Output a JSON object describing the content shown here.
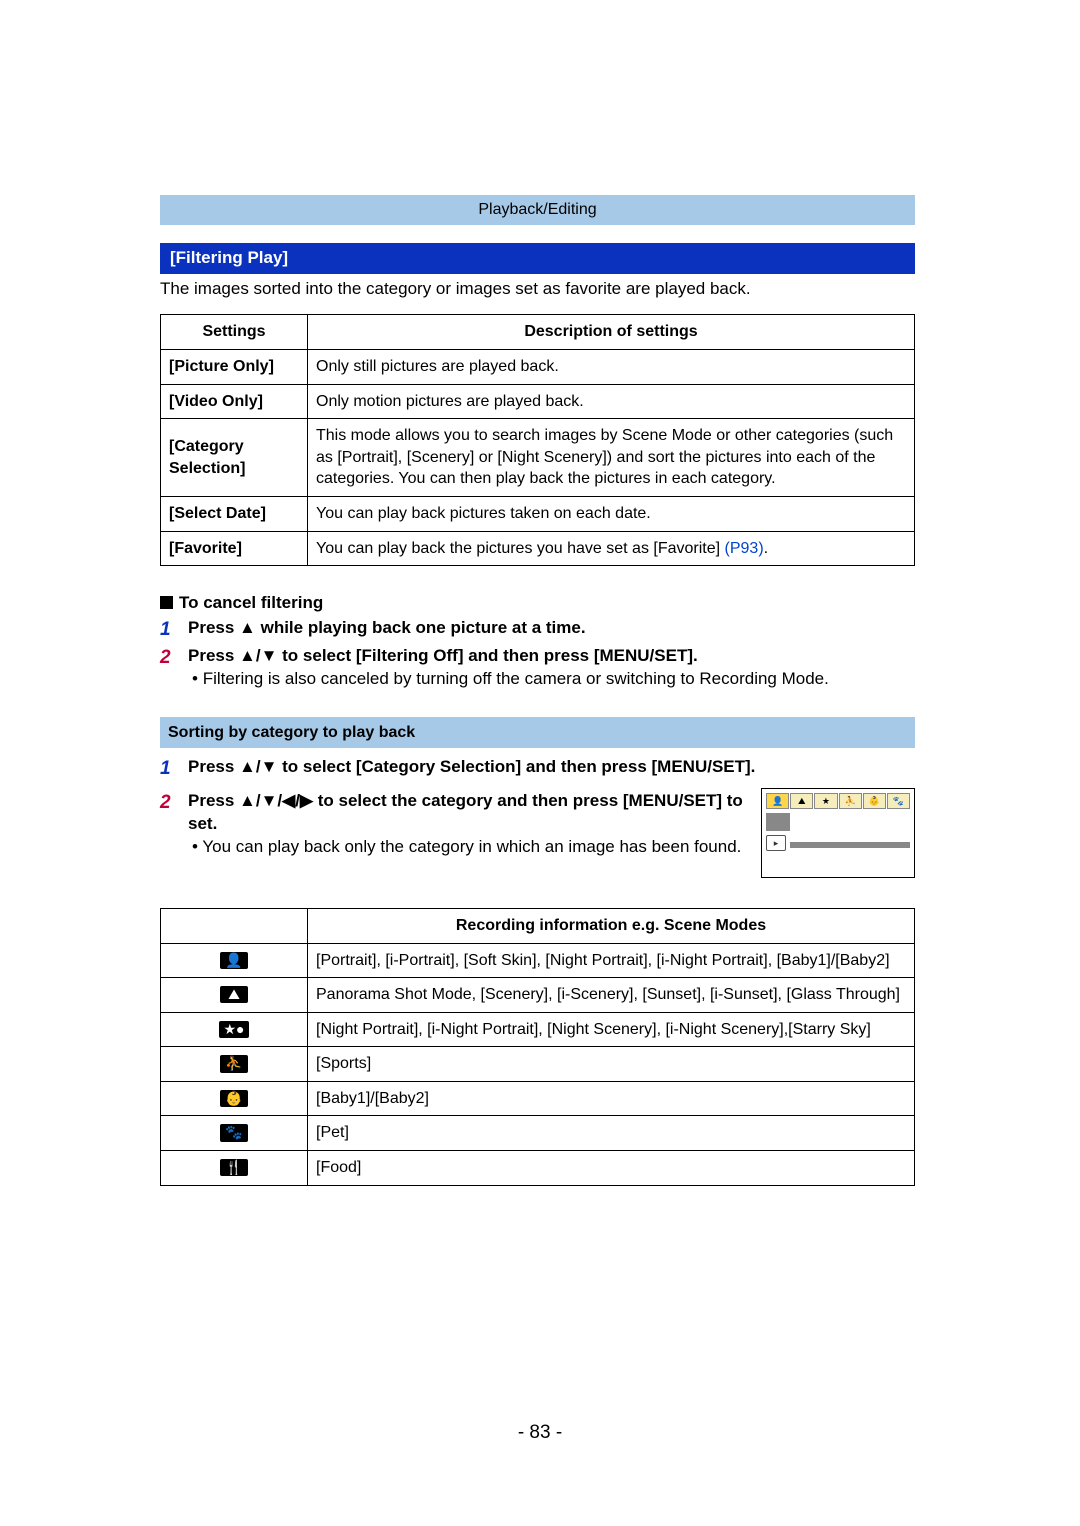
{
  "breadcrumb": "Playback/Editing",
  "title": "[Filtering Play]",
  "intro": "The images sorted into the category or images set as favorite are played back.",
  "settings_table": {
    "head": {
      "c1": "Settings",
      "c2": "Description of settings"
    },
    "rows": [
      {
        "name": "[Picture Only]",
        "desc": "Only still pictures are played back."
      },
      {
        "name": "[Video Only]",
        "desc": "Only motion pictures are played back."
      },
      {
        "name": "[Category Selection]",
        "desc": "This mode allows you to search images by Scene Mode or other categories (such as [Portrait], [Scenery] or [Night Scenery]) and sort the pictures into each of the categories. You can then play back the pictures in each category."
      },
      {
        "name": "[Select Date]",
        "desc": "You can play back pictures taken on each date."
      },
      {
        "name": "[Favorite]",
        "desc_pre": "You can play back the pictures you have set as [Favorite] ",
        "link": "(P93)",
        "desc_post": "."
      }
    ]
  },
  "cancel": {
    "heading": "To cancel filtering",
    "step1": "Press ▲ while playing back one picture at a time.",
    "step2": "Press ▲/▼ to select [Filtering Off] and then press [MENU/SET].",
    "note": "Filtering is also canceled by turning off the camera or switching to Recording Mode."
  },
  "sort": {
    "heading": "Sorting by category to play back",
    "step1": "Press ▲/▼ to select [Category Selection] and then press [MENU/SET].",
    "step2": "Press ▲/▼/◀/▶ to select the category and then press [MENU/SET] to set.",
    "note": "You can play back only the category in which an image has been found."
  },
  "rec_table": {
    "head": "Recording information e.g. Scene Modes",
    "rows": [
      {
        "icon": "👤",
        "name": "portrait-icon",
        "desc": "[Portrait], [i-Portrait], [Soft Skin], [Night Portrait], [i-Night Portrait], [Baby1]/[Baby2]"
      },
      {
        "icon": "⛰",
        "name": "scenery-icon",
        "desc": "Panorama Shot Mode, [Scenery], [i-Scenery], [Sunset], [i-Sunset], [Glass Through]"
      },
      {
        "icon": "★●",
        "name": "night-scenery-icon",
        "desc": "[Night Portrait], [i-Night Portrait], [Night Scenery], [i-Night Scenery],[Starry Sky]"
      },
      {
        "icon": "⛹",
        "name": "sports-icon",
        "desc": "[Sports]"
      },
      {
        "icon": "👶",
        "name": "baby-icon",
        "desc": "[Baby1]/[Baby2]"
      },
      {
        "icon": "🐾",
        "name": "pet-icon",
        "desc": "[Pet]"
      },
      {
        "icon": "🍴",
        "name": "food-icon",
        "desc": "[Food]"
      }
    ]
  },
  "page_number": "- 83 -"
}
